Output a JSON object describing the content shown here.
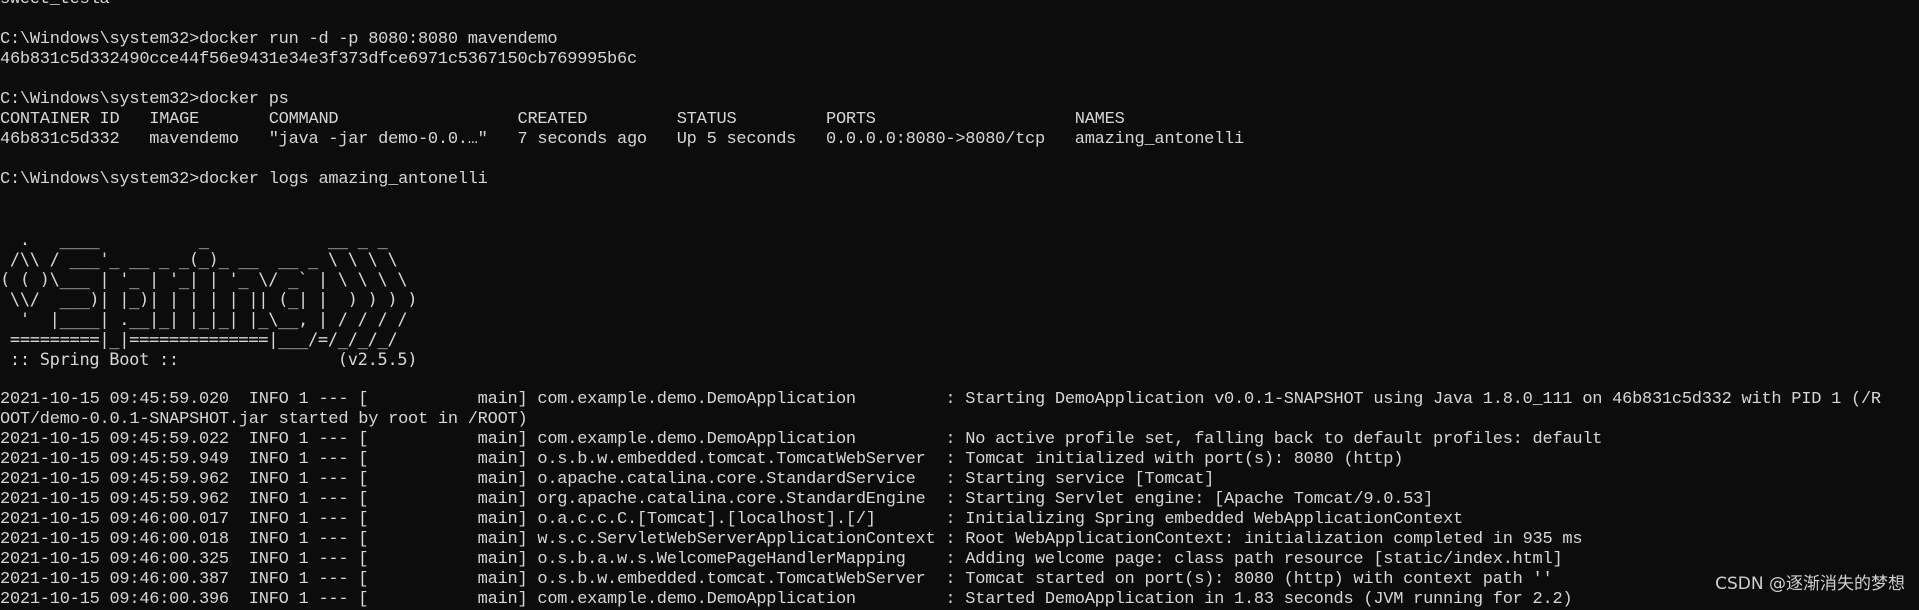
{
  "colors": {
    "background": "#0c0c0c",
    "foreground": "#d6d6d6"
  },
  "terminal": {
    "lines_before_banner": [
      "sweet_tesla",
      "",
      "C:\\Windows\\system32>docker run -d -p 8080:8080 mavendemo",
      "46b831c5d332490cce44f56e9431e34e3f373dfce6971c5367150cb769995b6c",
      "",
      "C:\\Windows\\system32>docker ps",
      "CONTAINER ID   IMAGE       COMMAND                  CREATED         STATUS         PORTS                    NAMES",
      "46b831c5d332   mavendemo   \"java -jar demo-0.0.…\"   7 seconds ago   Up 5 seconds   0.0.0.0:8080->8080/tcp   amazing_antonelli",
      "",
      "C:\\Windows\\system32>docker logs amazing_antonelli",
      "",
      ""
    ],
    "banner": [
      "  .   ____          _            __ _ _",
      " /\\\\ / ___'_ __ _ _(_)_ __  __ _ \\ \\ \\ \\",
      "( ( )\\___ | '_ | '_| | '_ \\/ _` | \\ \\ \\ \\",
      " \\\\/  ___)| |_)| | | | | || (_| |  ) ) ) )",
      "  '  |____| .__|_| |_|_| |_\\__, | / / / /",
      " =========|_|==============|___/=/_/_/_/",
      " :: Spring Boot ::                (v2.5.5)",
      ""
    ],
    "log_lines": [
      "2021-10-15 09:45:59.020  INFO 1 --- [           main] com.example.demo.DemoApplication         : Starting DemoApplication v0.0.1-SNAPSHOT using Java 1.8.0_111 on 46b831c5d332 with PID 1 (/R",
      "OOT/demo-0.0.1-SNAPSHOT.jar started by root in /ROOT)",
      "2021-10-15 09:45:59.022  INFO 1 --- [           main] com.example.demo.DemoApplication         : No active profile set, falling back to default profiles: default",
      "2021-10-15 09:45:59.949  INFO 1 --- [           main] o.s.b.w.embedded.tomcat.TomcatWebServer  : Tomcat initialized with port(s): 8080 (http)",
      "2021-10-15 09:45:59.962  INFO 1 --- [           main] o.apache.catalina.core.StandardService   : Starting service [Tomcat]",
      "2021-10-15 09:45:59.962  INFO 1 --- [           main] org.apache.catalina.core.StandardEngine  : Starting Servlet engine: [Apache Tomcat/9.0.53]",
      "2021-10-15 09:46:00.017  INFO 1 --- [           main] o.a.c.c.C.[Tomcat].[localhost].[/]       : Initializing Spring embedded WebApplicationContext",
      "2021-10-15 09:46:00.018  INFO 1 --- [           main] w.s.c.ServletWebServerApplicationContext : Root WebApplicationContext: initialization completed in 935 ms",
      "2021-10-15 09:46:00.325  INFO 1 --- [           main] o.s.b.a.w.s.WelcomePageHandlerMapping    : Adding welcome page: class path resource [static/index.html]",
      "2021-10-15 09:46:00.387  INFO 1 --- [           main] o.s.b.w.embedded.tomcat.TomcatWebServer  : Tomcat started on port(s): 8080 (http) with context path ''",
      "2021-10-15 09:46:00.396  INFO 1 --- [           main] com.example.demo.DemoApplication         : Started DemoApplication in 1.83 seconds (JVM running for 2.2)"
    ]
  },
  "watermark": "CSDN @逐渐消失的梦想"
}
